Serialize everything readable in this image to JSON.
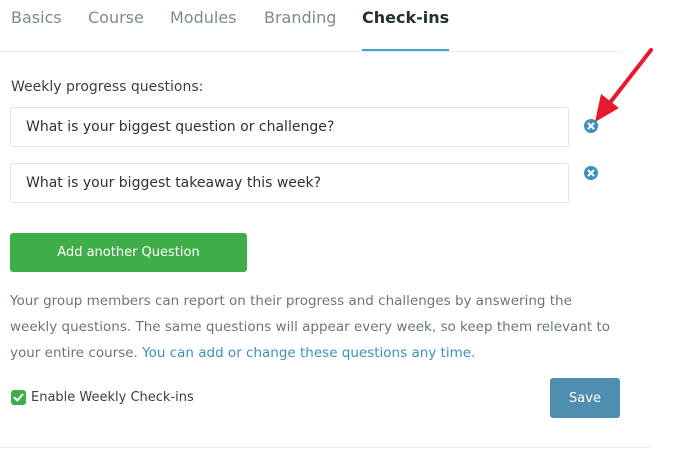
{
  "tabs": [
    {
      "label": "Basics"
    },
    {
      "label": "Course"
    },
    {
      "label": "Modules"
    },
    {
      "label": "Branding"
    },
    {
      "label": "Check-ins",
      "active": true
    }
  ],
  "section_label": "Weekly progress questions:",
  "questions": [
    {
      "value": "What is your biggest question or challenge?",
      "remove_icon": "times-circle-icon"
    },
    {
      "value": "What is your biggest takeaway this week?",
      "remove_icon": "times-circle-icon"
    }
  ],
  "add_button_label": "Add another Question",
  "description": {
    "text": "Your group members can report on their progress and challenges by answering the weekly questions. The same questions will appear every week, so keep them relevant to your entire course. ",
    "link": "You can add or change these questions any time."
  },
  "enable_checkins": {
    "label": "Enable Weekly Check-ins",
    "checked": true
  },
  "save_label": "Save",
  "colors": {
    "accent_green": "#3fae49",
    "save_blue": "#4e8fb0",
    "link_blue": "#3d8fbd",
    "tab_underline": "#45a5c8",
    "annotation_red": "#e8192c"
  }
}
